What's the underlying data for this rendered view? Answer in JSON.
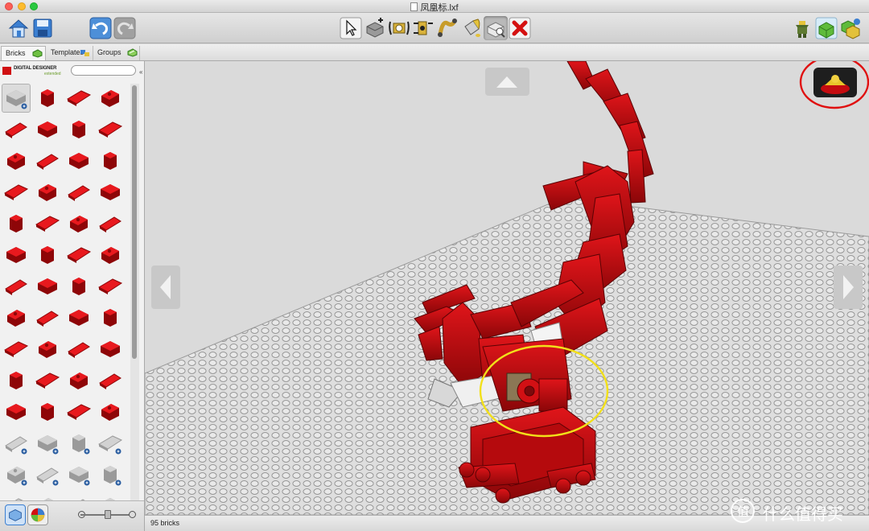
{
  "window": {
    "title": "凤凰标.lxf"
  },
  "toolbar": {
    "left": [
      {
        "name": "home-button",
        "icon": "home-icon"
      },
      {
        "name": "save-button",
        "icon": "save-icon"
      },
      {
        "name": "undo-button",
        "icon": "undo-icon"
      },
      {
        "name": "redo-button",
        "icon": "redo-icon"
      }
    ],
    "center": [
      {
        "name": "select-tool-button",
        "icon": "cursor-icon"
      },
      {
        "name": "clone-tool-button",
        "icon": "clone-icon"
      },
      {
        "name": "hinge-tool-button",
        "icon": "hinge-icon"
      },
      {
        "name": "hinge-align-tool-button",
        "icon": "hinge-align-icon"
      },
      {
        "name": "flex-tool-button",
        "icon": "flex-icon"
      },
      {
        "name": "paint-tool-button",
        "icon": "paint-bucket-icon"
      },
      {
        "name": "hide-tool-button",
        "icon": "hide-icon"
      },
      {
        "name": "delete-tool-button",
        "icon": "delete-icon"
      }
    ],
    "right": [
      {
        "name": "build-mode-button",
        "icon": "minifig-icon"
      },
      {
        "name": "view-mode-button",
        "icon": "view-mode-icon"
      },
      {
        "name": "build-guide-button",
        "icon": "build-guide-icon"
      }
    ]
  },
  "tabs": [
    {
      "label": "Bricks",
      "active": true,
      "icon": "bricks-icon"
    },
    {
      "label": "Templates",
      "active": false,
      "icon": "templates-icon"
    },
    {
      "label": "Groups",
      "active": false,
      "icon": "groups-icon"
    }
  ],
  "palette": {
    "logo_text": "DIGITAL DESIGNER",
    "logo_subtext": "extended",
    "search_value": "",
    "brick_color": "#d01012",
    "bricks": [
      "brick-2x2-grey",
      "brick-2x2",
      "brick-2x3",
      "brick-2x4",
      "brick-1x2",
      "brick-1x2-slope",
      "brick-2x2-slope",
      "brick-1x1",
      "brick-1x2-round",
      "brick-2x2-curve",
      "brick-2x2-corner",
      "brick-2x3-wedge",
      "plate-1x4",
      "plate-1x6",
      "plate-2x4",
      "plate-1x3",
      "brick-1x1-tall",
      "brick-1x2-tall",
      "plate-2x3",
      "plate-1x4-thin",
      "plate-1x6-long",
      "plate-2x6",
      "plate-1x8",
      "brick-1x1-column",
      "plate-1x6-flat",
      "brick-2x2-tall",
      "plate-1x8-flat",
      "plate-2x4-flat",
      "brick-1x2-column",
      "plate-1x10",
      "plate-2x2-flat",
      "plate-2x4-wedge",
      "plate-1x4-diag",
      "brick-2x2-block",
      "brick-2x3-block",
      "plate-2x6-flat",
      "brick-1x2-curve",
      "brick-2x2-arch",
      "plate-2x4-tile",
      "plate-2x6-tile",
      "plate-4x4",
      "plate-1x8-tile",
      "plate-2x8",
      "plate-4x6",
      "technic-brick-2x2-grey",
      "technic-brick-2x2b-grey",
      "technic-plate-2x4-grey",
      "technic-plate-2x2-grey",
      "technic-beam-grey",
      "technic-curve-grey",
      "technic-plate-2x3-grey",
      "technic-joint-grey",
      "technic-pin-grey",
      "technic-pin2-grey",
      "technic-axle-grey",
      "technic-hub-grey"
    ]
  },
  "status": {
    "brick_count": "95 bricks"
  },
  "watermark": {
    "glyph": "值",
    "text": "什么值得买"
  },
  "annotations": {
    "red_circle_color": "#e01010",
    "yellow_circle_color": "#f2e01a"
  }
}
